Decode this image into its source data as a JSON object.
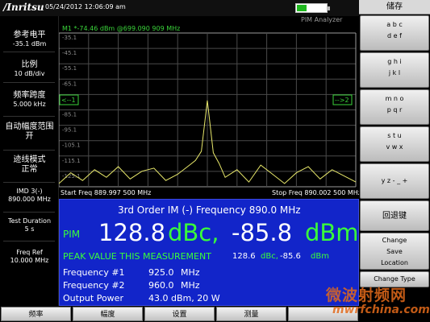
{
  "topbar": {
    "logo": "/Inritsu",
    "datetime": "05/24/2012 12:06:09 am"
  },
  "left_panel": [
    {
      "label": "参考电平",
      "value": "-35.1 dBm"
    },
    {
      "label": "比例",
      "value": "10 dB/div"
    },
    {
      "label": "频率跨度",
      "value": "5.000 kHz"
    },
    {
      "label": "自动幅度范围",
      "value": "开"
    },
    {
      "label": "迹线模式",
      "value": "正常"
    },
    {
      "label": "IMD 3(-)",
      "value": "890.000 MHz"
    },
    {
      "label": "Test Duration",
      "value": "5 s"
    },
    {
      "label": "Freq Ref",
      "value": "10.000 MHz"
    }
  ],
  "graph": {
    "mode_label": "PIM Analyzer",
    "marker_readout": "M1 *-74.46 dBm @699.090 909 MHz",
    "left_arrow": "<--1",
    "right_arrow": "-->2",
    "start_freq": "Start Freq 889.997 500 MHz",
    "stop_freq": "Stop Freq 890.002 500 MHz"
  },
  "chart_data": {
    "type": "line",
    "title": "",
    "xlabel": "",
    "ylabel": "",
    "xlim_mhz": [
      889.9975,
      890.0025
    ],
    "ylim": [
      -135.1,
      -35.1
    ],
    "y_tick_labels": [
      "-35.1",
      "-45.1",
      "-55.1",
      "-65.1",
      "-75.1",
      "-85.1",
      "-95.1",
      "-105.1",
      "-115.1",
      "-125.1"
    ],
    "grid": true,
    "series": [
      {
        "trace_color": "#e8e86a",
        "x_mhz": [
          889.9975,
          889.9977,
          889.9979,
          889.9981,
          889.9983,
          889.9985,
          889.9987,
          889.9989,
          889.9991,
          889.9993,
          889.9995,
          889.9997,
          889.9998,
          889.9999,
          890.0,
          890.0001,
          890.0002,
          890.0003,
          890.0005,
          890.0007,
          890.0009,
          890.0011,
          890.0013,
          890.0015,
          890.0017,
          890.0019,
          890.0021,
          890.0023,
          890.0025
        ],
        "y_dbm": [
          -133,
          -126,
          -131,
          -124,
          -129,
          -122,
          -130,
          -125,
          -123,
          -131,
          -127,
          -121,
          -118,
          -112,
          -79,
          -113,
          -120,
          -129,
          -124,
          -132,
          -121,
          -127,
          -133,
          -126,
          -122,
          -130,
          -124,
          -128,
          -132
        ]
      }
    ]
  },
  "measurement": {
    "title": "3rd Order IM (-) Frequency   890.0 MHz",
    "pim_label": "PIM",
    "pim_value1": "128.8",
    "pim_unit1": "dBc,",
    "pim_value2": "-85.8",
    "pim_unit2": "dBm",
    "peak_label": "PEAK VALUE THIS MEASUREMENT",
    "peak_value1": "128.6",
    "peak_unit1": "dBc,",
    "peak_value2": "-85.6",
    "peak_unit2": "dBm",
    "rows": [
      {
        "label": "Frequency #1",
        "value": "925.0",
        "unit": "MHz"
      },
      {
        "label": "Frequency #2",
        "value": "960.0",
        "unit": "MHz"
      },
      {
        "label": "Output Power",
        "value": "43.0 dBm,  20 W",
        "unit": ""
      }
    ]
  },
  "right_menu": {
    "title": "储存",
    "buttons": [
      [
        "a b c",
        "d e f"
      ],
      [
        "g h i",
        "j k l"
      ],
      [
        "m n o",
        "p q r"
      ],
      [
        "s t u",
        "v w x"
      ],
      [
        "y z - _ +"
      ],
      [
        "回退键"
      ],
      [
        "Change",
        "Save",
        "Location"
      ],
      [
        "Change Type"
      ]
    ]
  },
  "bottom_tabs": [
    "频率",
    "幅度",
    "设置",
    "测量",
    ""
  ],
  "watermark": {
    "line1": "微波射频网",
    "line2": "mwrfchina.com"
  },
  "colors": {
    "measurement_bg": "#1225c9",
    "accent_green": "#39ff39",
    "trace": "#e8e86a"
  }
}
